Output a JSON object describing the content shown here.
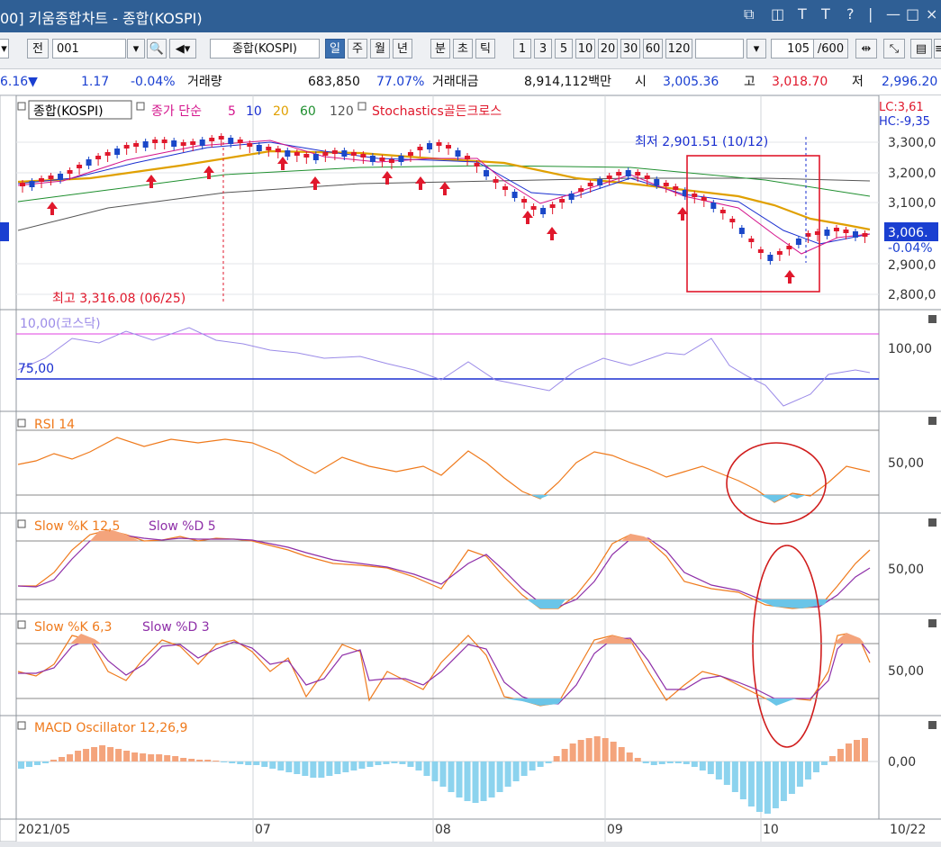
{
  "titlebar": {
    "title": "00] 키움종합차트 - 종합(KOSPI)"
  },
  "toolbar": {
    "prefix_label": "전",
    "code": "001",
    "name": "종합(KOSPI)",
    "period_buttons": [
      "일",
      "주",
      "월",
      "년",
      "분",
      "초",
      "틱"
    ],
    "selected_period": "일",
    "interval_buttons": [
      "1",
      "3",
      "5",
      "10",
      "20",
      "30",
      "60",
      "120"
    ],
    "count": "105",
    "total": "/600"
  },
  "quote": {
    "price": "6.16▼",
    "change": "1.17",
    "change_pct": "-0.04%",
    "volume_label": "거래량",
    "volume": "683,850",
    "volume_pct": "77.07%",
    "amount_label": "거래대금",
    "amount": "8,914,112백만",
    "open_label": "시",
    "open": "3,005.36",
    "high_label": "고",
    "high": "3,018.70",
    "low_label": "저",
    "low": "2,996.20"
  },
  "panels": {
    "price": {
      "legend_symbol": "종합(KOSPI)",
      "ma_label": "종가 단순",
      "ma_periods": [
        "5",
        "10",
        "20",
        "60",
        "120"
      ],
      "ma_colors": [
        "#d4148c",
        "#1a2fd0",
        "#e0a000",
        "#1f8f2f",
        "#555555"
      ],
      "signal_label": "Stochastics골든크로스",
      "low_annotation": "최저 2,901.51 (10/12)",
      "high_annotation": "최고 3,316.08 (06/25)",
      "axis_ticks": [
        "3,300,0",
        "3,200,0",
        "3,100,0",
        "2,900,0",
        "2,800,0"
      ],
      "last_tag": "3,006.",
      "last_pct": "-0.04%",
      "lc": "LC:3,61",
      "hc": "HC:-9,35"
    },
    "kosdaq": {
      "title": "10,00(코스닥)",
      "ref_line": "75,00",
      "axis_tick": "100,00"
    },
    "rsi": {
      "title": "RSI 14",
      "axis_tick": "50,00"
    },
    "stoch1": {
      "title_k": "Slow %K 12,5",
      "title_d": "Slow %D 5",
      "axis_tick": "50,00"
    },
    "stoch2": {
      "title_k": "Slow %K 6,3",
      "title_d": "Slow %D 3",
      "axis_tick": "50,00"
    },
    "macd": {
      "title": "MACD Oscillator 12,26,9",
      "axis_tick": "0,00"
    }
  },
  "xaxis": {
    "labels": [
      "2021/05",
      "07",
      "08",
      "09",
      "10"
    ],
    "last": "10/22"
  }
}
